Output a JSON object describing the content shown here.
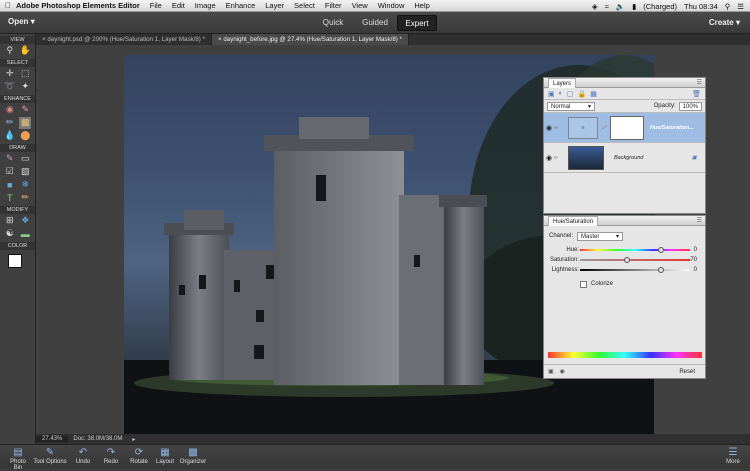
{
  "menubar": {
    "app": "Adobe Photoshop Elements Editor",
    "items": [
      "File",
      "Edit",
      "Image",
      "Enhance",
      "Layer",
      "Select",
      "Filter",
      "View",
      "Window",
      "Help"
    ],
    "battery": "(Charged)",
    "clock": "Thu 08:34"
  },
  "topbar": {
    "open": "Open",
    "modes": [
      "Quick",
      "Guided",
      "Expert"
    ],
    "active_mode": "Expert",
    "create": "Create"
  },
  "tabs": [
    "daynight.psd @ 200% (Hue/Saturation 1, Layer Mask/8) *",
    "daynight_before.jpg @ 27.4% (Hue/Saturation 1, Layer Mask/8) *"
  ],
  "toolbox": {
    "sections": [
      "VIEW",
      "SELECT",
      "ENHANCE",
      "DRAW",
      "MODIFY",
      "COLOR"
    ]
  },
  "status": {
    "zoom": "27.43%",
    "doc": "Doc: 38.0M/38.0M"
  },
  "layers": {
    "tab": "Layers",
    "blend": "Normal",
    "opacity_label": "Opacity:",
    "opacity": "100%",
    "items": [
      {
        "name": "Hue/Saturation...",
        "active": true
      },
      {
        "name": "Background",
        "active": false
      }
    ]
  },
  "huesat": {
    "title": "Hue/Saturation",
    "channel_label": "Channel:",
    "channel": "Master",
    "hue_label": "Hue:",
    "hue": "0",
    "sat_label": "Saturation:",
    "sat": "-70",
    "light_label": "Lightness:",
    "light": "0",
    "colorize": "Colorize",
    "reset": "Reset"
  },
  "bottombar": [
    "Photo Bin",
    "Tool Options",
    "Undo",
    "Redo",
    "Rotate",
    "Layout",
    "Organizer",
    "More"
  ]
}
